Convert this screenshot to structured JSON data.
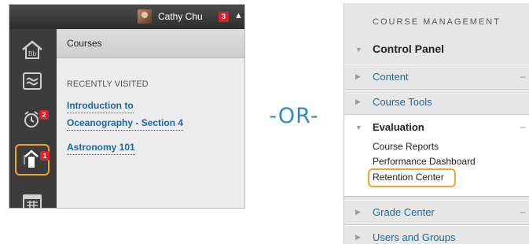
{
  "left": {
    "user": {
      "name": "Cathy Chu",
      "notification_count": "3"
    },
    "rail": {
      "calendar_badge": "2",
      "history_badge": "1",
      "icons": [
        "blackboard-home-icon",
        "activity-stream-icon",
        "alarm-clock-icon",
        "history-arrow-icon",
        "calendar-icon"
      ]
    },
    "courses_title": "Courses",
    "recently_visited_label": "RECENTLY VISITED",
    "recent_courses": [
      {
        "line1": "Introduction to",
        "line2": "Oceanography - Section 4"
      },
      {
        "line1": "Astronomy 101"
      }
    ]
  },
  "separator": "-OR-",
  "right": {
    "title": "COURSE MANAGEMENT",
    "control_panel": "Control Panel",
    "content": "Content",
    "course_tools": "Course Tools",
    "evaluation": "Evaluation",
    "evaluation_items": [
      "Course Reports",
      "Performance Dashboard",
      "Retention Center"
    ],
    "grade_center": "Grade Center",
    "users_groups": "Users and Groups"
  },
  "colors": {
    "highlight": "#f2a32c",
    "link": "#1a6aa2",
    "badge": "#d8232a",
    "or_text": "#2f88c7"
  }
}
